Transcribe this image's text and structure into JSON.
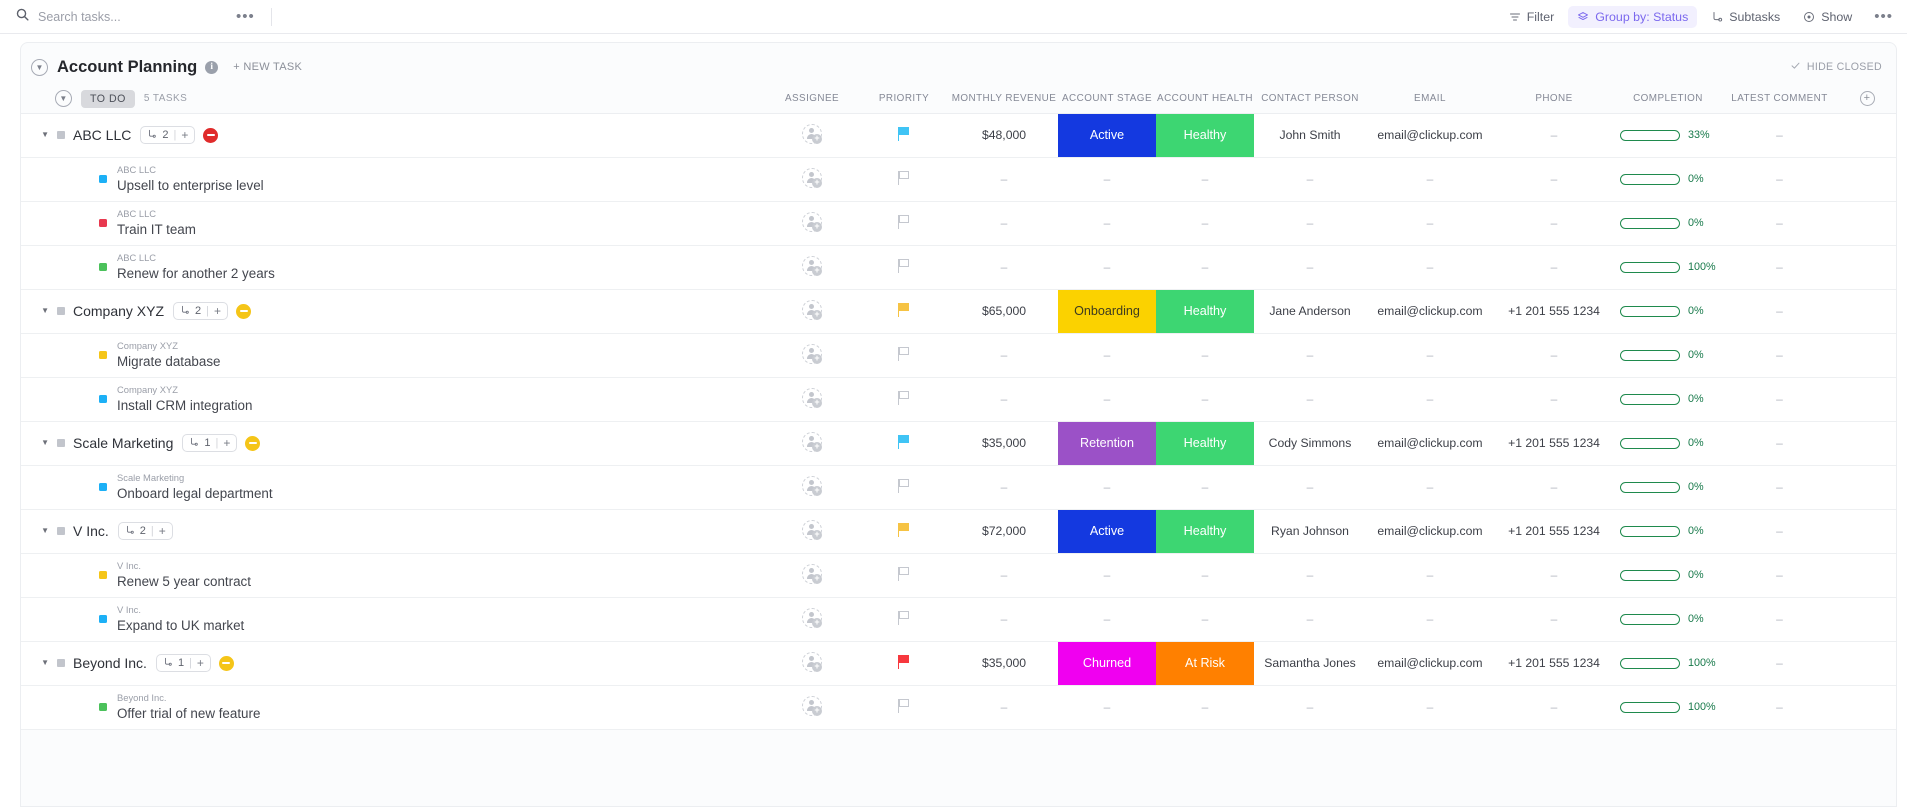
{
  "topbar": {
    "search_placeholder": "Search tasks...",
    "search_value": "",
    "more_label": "•••",
    "filter_label": "Filter",
    "groupby_label": "Group by: Status",
    "subtasks_label": "Subtasks",
    "show_label": "Show",
    "overflow_label": "•••"
  },
  "page": {
    "title": "Account Planning",
    "new_task_label": "+ NEW TASK",
    "hide_closed_label": "HIDE CLOSED"
  },
  "group": {
    "status_label": "TO DO",
    "task_count_label": "5 TASKS"
  },
  "columns": [
    {
      "key": "name",
      "label": ""
    },
    {
      "key": "assignee",
      "label": "ASSIGNEE"
    },
    {
      "key": "priority",
      "label": "PRIORITY"
    },
    {
      "key": "monthly_revenue",
      "label": "MONTHLY REVENUE"
    },
    {
      "key": "account_stage",
      "label": "ACCOUNT STAGE"
    },
    {
      "key": "account_health",
      "label": "ACCOUNT HEALTH"
    },
    {
      "key": "contact_person",
      "label": "CONTACT PERSON"
    },
    {
      "key": "email",
      "label": "EMAIL"
    },
    {
      "key": "phone",
      "label": "PHONE"
    },
    {
      "key": "completion",
      "label": "COMPLETION"
    },
    {
      "key": "latest_comment",
      "label": "LATEST COMMENT"
    },
    {
      "key": "add",
      "label": ""
    }
  ],
  "colors": {
    "active": "#1439e0",
    "onboarding": "#fbd200",
    "retention": "#9b51c7",
    "churned": "#f000f0",
    "healthy": "#3dd672",
    "at_risk": "#ff8000",
    "flag_high": "#40c4f5",
    "flag_normal": "#f6c344",
    "flag_urgent": "#f7383e",
    "accent": "#7b68ee",
    "progress": "#0f8341"
  },
  "rows": [
    {
      "type": "parent",
      "name": "ABC LLC",
      "subtask_count": "2",
      "subtask_plus": "+",
      "status_icon": "circle-minus-icon",
      "status_icon_color": "#e02b2b",
      "priority": "flag-filled",
      "priority_color": "#40c4f5",
      "monthly_revenue": "$48,000",
      "account_stage": "Active",
      "stage_color": "#1439e0",
      "stage_text_color": "#ffffff",
      "account_health": "Healthy",
      "health_color": "#3dd672",
      "health_text_color": "#ffffff",
      "contact_person": "John Smith",
      "email": "email@clickup.com",
      "phone": "–",
      "completion": "33%",
      "completion_pct": 33,
      "latest_comment": "–"
    },
    {
      "type": "child",
      "parent_name": "ABC LLC",
      "name": "Upsell to enterprise level",
      "square_color": "#1cb0f6",
      "priority": "flag-outline",
      "monthly_revenue": "–",
      "account_stage": "–",
      "account_health": "–",
      "contact_person": "–",
      "email": "–",
      "phone": "–",
      "completion": "0%",
      "completion_pct": 0,
      "latest_comment": "–"
    },
    {
      "type": "child",
      "parent_name": "ABC LLC",
      "name": "Train IT team",
      "square_color": "#e8384f",
      "priority": "flag-outline",
      "monthly_revenue": "–",
      "account_stage": "–",
      "account_health": "–",
      "contact_person": "–",
      "email": "–",
      "phone": "–",
      "completion": "0%",
      "completion_pct": 0,
      "latest_comment": "–"
    },
    {
      "type": "child",
      "parent_name": "ABC LLC",
      "name": "Renew for another 2 years",
      "square_color": "#4bc15b",
      "priority": "flag-outline",
      "monthly_revenue": "–",
      "account_stage": "–",
      "account_health": "–",
      "contact_person": "–",
      "email": "–",
      "phone": "–",
      "completion": "100%",
      "completion_pct": 100,
      "latest_comment": "–"
    },
    {
      "type": "parent",
      "name": "Company XYZ",
      "subtask_count": "2",
      "subtask_plus": "+",
      "status_icon": "circle-minus-icon",
      "status_icon_color": "#f5c518",
      "priority": "flag-filled",
      "priority_color": "#f6c344",
      "monthly_revenue": "$65,000",
      "account_stage": "Onboarding",
      "stage_color": "#fbd200",
      "stage_text_color": "#3d3b20",
      "account_health": "Healthy",
      "health_color": "#3dd672",
      "health_text_color": "#ffffff",
      "contact_person": "Jane Anderson",
      "email": "email@clickup.com",
      "phone": "+1 201 555 1234",
      "completion": "0%",
      "completion_pct": 0,
      "latest_comment": "–"
    },
    {
      "type": "child",
      "parent_name": "Company XYZ",
      "name": "Migrate database",
      "square_color": "#f5c518",
      "priority": "flag-outline",
      "monthly_revenue": "–",
      "account_stage": "–",
      "account_health": "–",
      "contact_person": "–",
      "email": "–",
      "phone": "–",
      "completion": "0%",
      "completion_pct": 0,
      "latest_comment": "–"
    },
    {
      "type": "child",
      "parent_name": "Company XYZ",
      "name": "Install CRM integration",
      "square_color": "#1cb0f6",
      "priority": "flag-outline",
      "monthly_revenue": "–",
      "account_stage": "–",
      "account_health": "–",
      "contact_person": "–",
      "email": "–",
      "phone": "–",
      "completion": "0%",
      "completion_pct": 0,
      "latest_comment": "–"
    },
    {
      "type": "parent",
      "name": "Scale Marketing",
      "subtask_count": "1",
      "subtask_plus": "+",
      "status_icon": "circle-minus-icon",
      "status_icon_color": "#f5c518",
      "priority": "flag-filled",
      "priority_color": "#40c4f5",
      "monthly_revenue": "$35,000",
      "account_stage": "Retention",
      "stage_color": "#9b51c7",
      "stage_text_color": "#ffffff",
      "account_health": "Healthy",
      "health_color": "#3dd672",
      "health_text_color": "#ffffff",
      "contact_person": "Cody Simmons",
      "email": "email@clickup.com",
      "phone": "+1 201 555 1234",
      "completion": "0%",
      "completion_pct": 0,
      "latest_comment": "–"
    },
    {
      "type": "child",
      "parent_name": "Scale Marketing",
      "name": "Onboard legal department",
      "square_color": "#1cb0f6",
      "priority": "flag-outline",
      "monthly_revenue": "–",
      "account_stage": "–",
      "account_health": "–",
      "contact_person": "–",
      "email": "–",
      "phone": "–",
      "completion": "0%",
      "completion_pct": 0,
      "latest_comment": "–"
    },
    {
      "type": "parent",
      "name": "V Inc.",
      "subtask_count": "2",
      "subtask_plus": "+",
      "status_icon": "",
      "status_icon_color": "",
      "priority": "flag-filled",
      "priority_color": "#f6c344",
      "monthly_revenue": "$72,000",
      "account_stage": "Active",
      "stage_color": "#1439e0",
      "stage_text_color": "#ffffff",
      "account_health": "Healthy",
      "health_color": "#3dd672",
      "health_text_color": "#ffffff",
      "contact_person": "Ryan Johnson",
      "email": "email@clickup.com",
      "phone": "+1 201 555 1234",
      "completion": "0%",
      "completion_pct": 0,
      "latest_comment": "–"
    },
    {
      "type": "child",
      "parent_name": "V Inc.",
      "name": "Renew 5 year contract",
      "square_color": "#f5c518",
      "priority": "flag-outline",
      "monthly_revenue": "–",
      "account_stage": "–",
      "account_health": "–",
      "contact_person": "–",
      "email": "–",
      "phone": "–",
      "completion": "0%",
      "completion_pct": 0,
      "latest_comment": "–"
    },
    {
      "type": "child",
      "parent_name": "V Inc.",
      "name": "Expand to UK market",
      "square_color": "#1cb0f6",
      "priority": "flag-outline",
      "monthly_revenue": "–",
      "account_stage": "–",
      "account_health": "–",
      "contact_person": "–",
      "email": "–",
      "phone": "–",
      "completion": "0%",
      "completion_pct": 0,
      "latest_comment": "–"
    },
    {
      "type": "parent",
      "name": "Beyond Inc.",
      "subtask_count": "1",
      "subtask_plus": "+",
      "status_icon": "circle-minus-icon",
      "status_icon_color": "#f5c518",
      "priority": "flag-filled",
      "priority_color": "#f7383e",
      "monthly_revenue": "$35,000",
      "account_stage": "Churned",
      "stage_color": "#f000f0",
      "stage_text_color": "#ffffff",
      "account_health": "At Risk",
      "health_color": "#ff8000",
      "health_text_color": "#ffffff",
      "contact_person": "Samantha Jones",
      "email": "email@clickup.com",
      "phone": "+1 201 555 1234",
      "completion": "100%",
      "completion_pct": 100,
      "latest_comment": "–"
    },
    {
      "type": "child",
      "parent_name": "Beyond Inc.",
      "name": "Offer trial of new feature",
      "square_color": "#4bc15b",
      "priority": "flag-outline",
      "monthly_revenue": "–",
      "account_stage": "–",
      "account_health": "–",
      "contact_person": "–",
      "email": "–",
      "phone": "–",
      "completion": "100%",
      "completion_pct": 100,
      "latest_comment": "–"
    }
  ]
}
